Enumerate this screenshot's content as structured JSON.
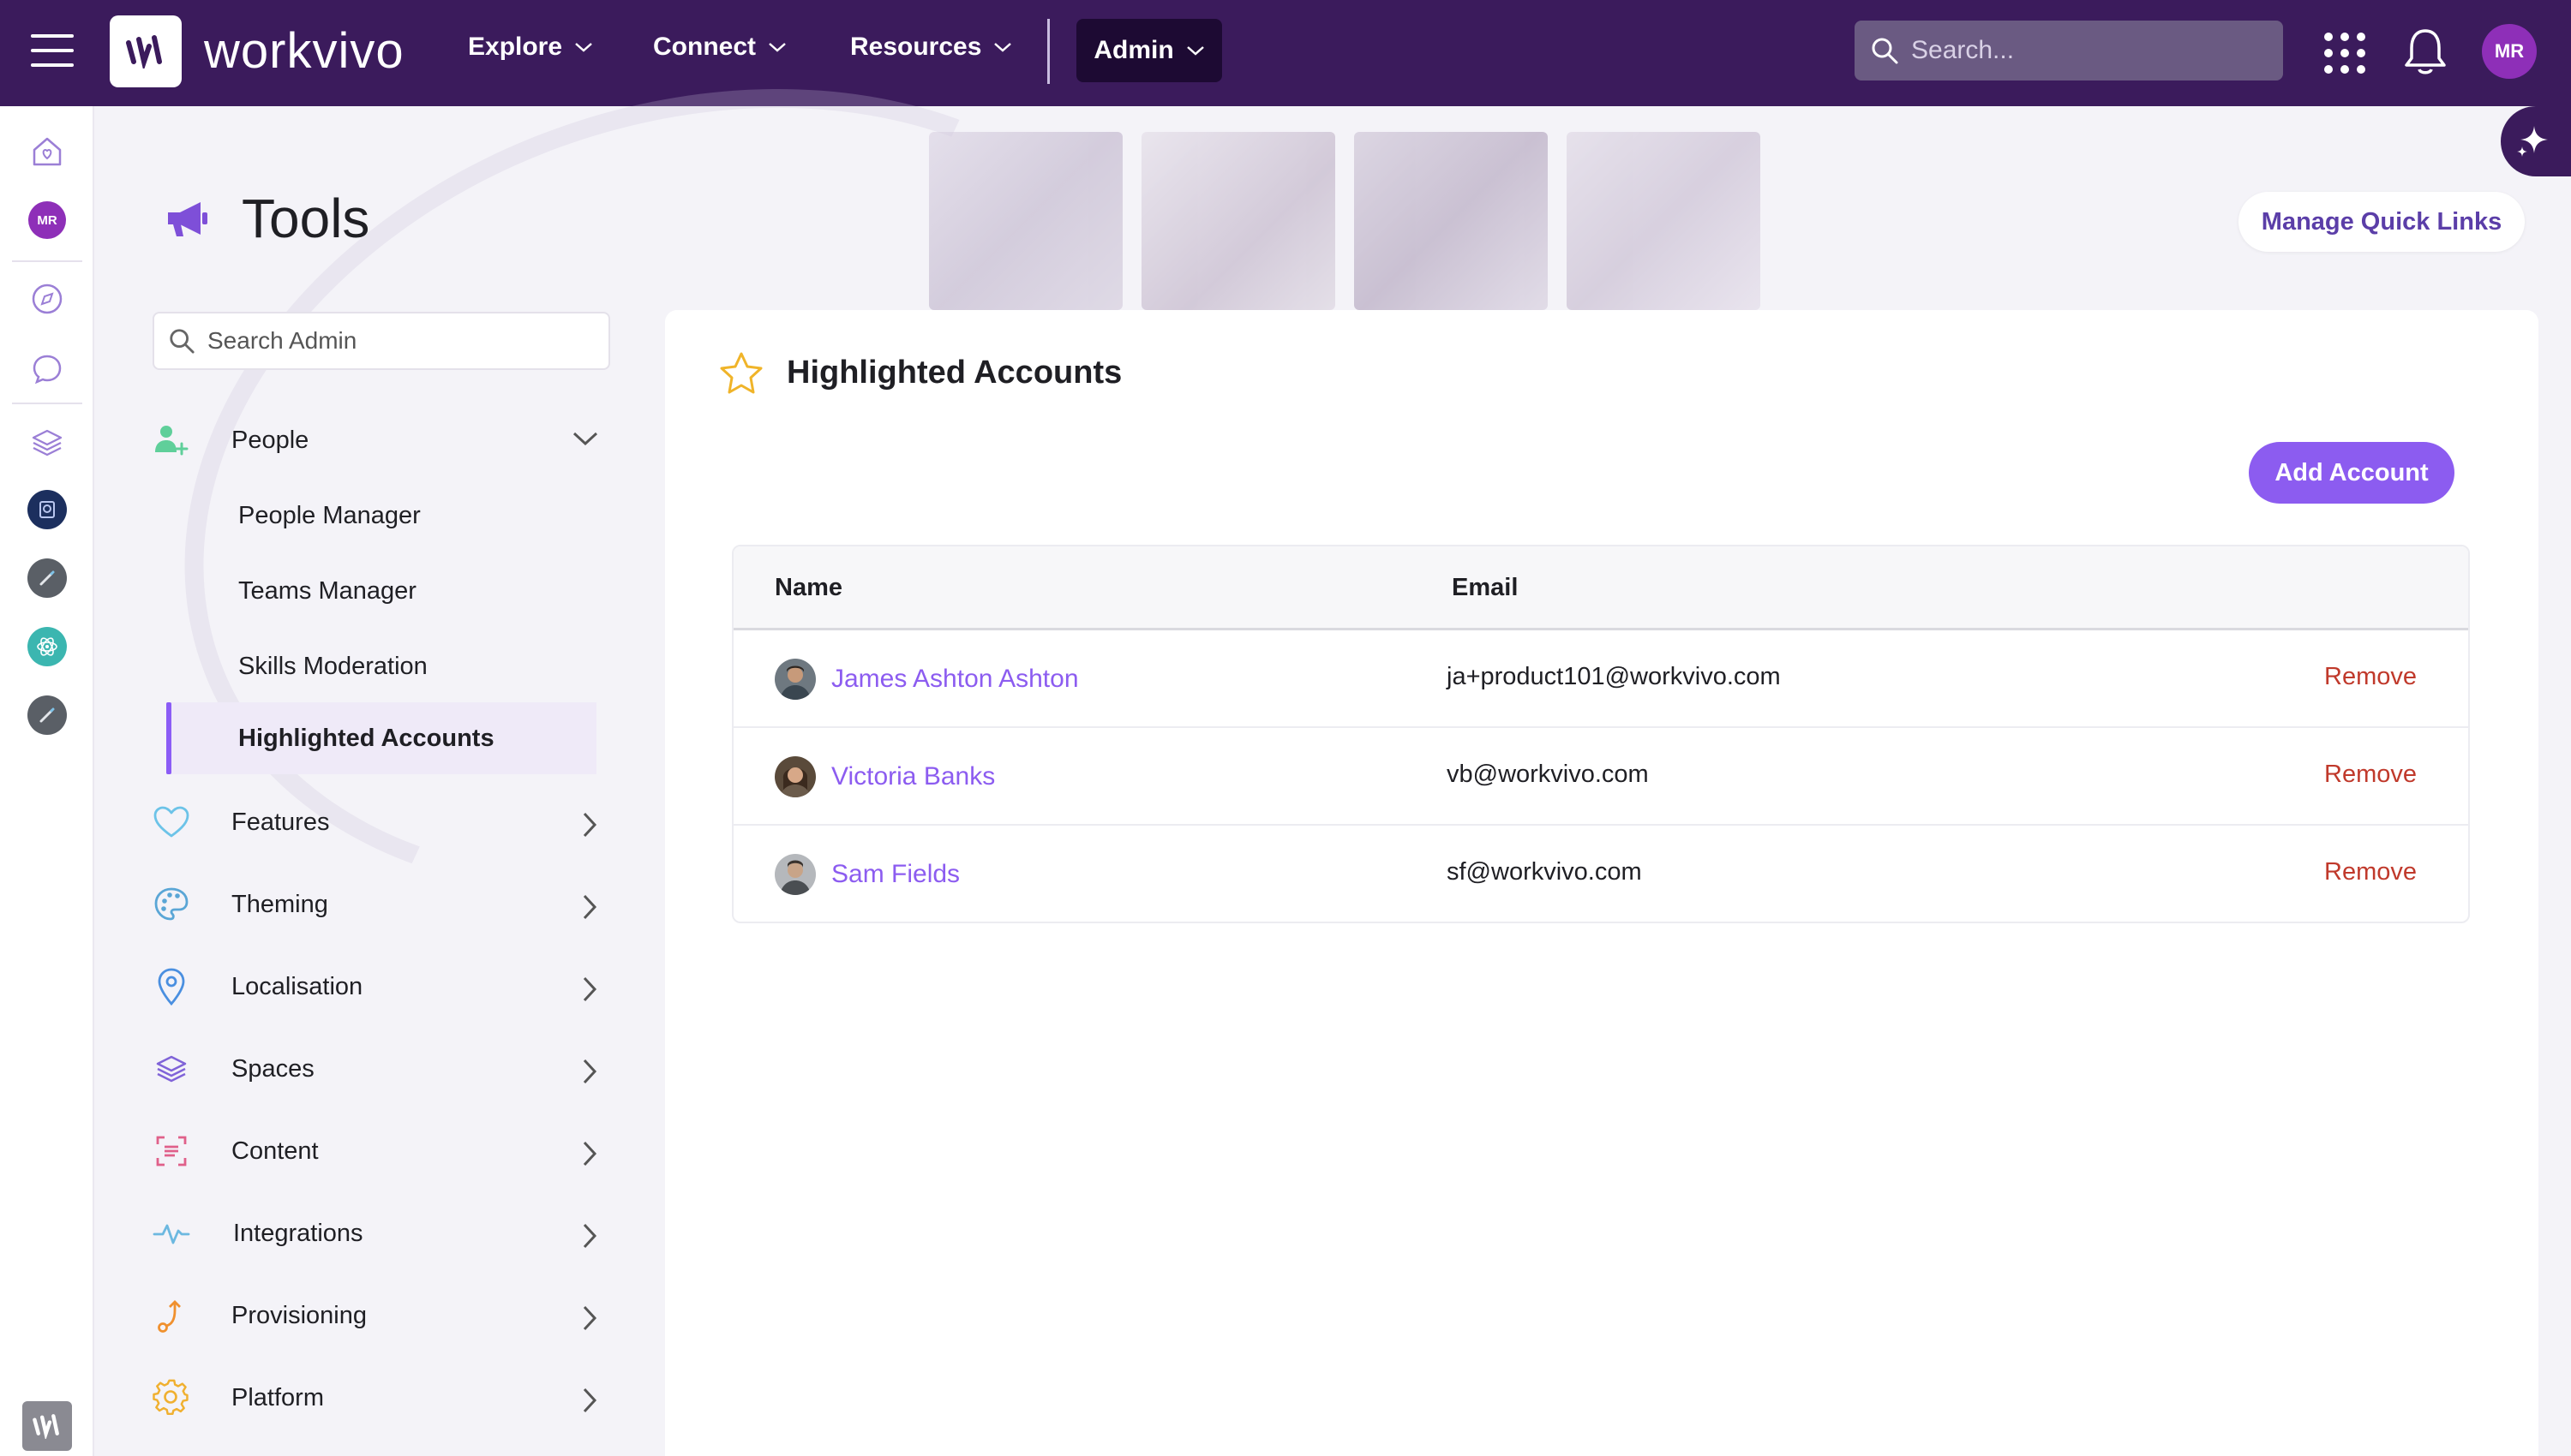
{
  "topbar": {
    "logo_text": "workvivo",
    "nav": [
      {
        "label": "Explore"
      },
      {
        "label": "Connect"
      },
      {
        "label": "Resources"
      }
    ],
    "admin_label": "Admin",
    "search_placeholder": "Search...",
    "avatar_initials": "MR"
  },
  "rail": {
    "avatar_initials": "MR"
  },
  "page": {
    "title": "Tools",
    "quick_links_label": "Manage Quick Links"
  },
  "sidebar": {
    "search_placeholder": "Search Admin",
    "people": {
      "label": "People",
      "sub_items": [
        {
          "label": "People Manager"
        },
        {
          "label": "Teams Manager"
        },
        {
          "label": "Skills Moderation"
        },
        {
          "label": "Highlighted Accounts"
        }
      ]
    },
    "items": [
      {
        "label": "Features"
      },
      {
        "label": "Theming"
      },
      {
        "label": "Localisation"
      },
      {
        "label": "Spaces"
      },
      {
        "label": "Content"
      },
      {
        "label": "Integrations"
      },
      {
        "label": "Provisioning"
      },
      {
        "label": "Platform"
      }
    ]
  },
  "main": {
    "title": "Highlighted Accounts",
    "add_button": "Add Account",
    "table": {
      "headers": {
        "name": "Name",
        "email": "Email"
      },
      "rows": [
        {
          "name": "James Ashton Ashton",
          "email": "ja+product101@workvivo.com",
          "action": "Remove"
        },
        {
          "name": "Victoria Banks",
          "email": "vb@workvivo.com",
          "action": "Remove"
        },
        {
          "name": "Sam Fields",
          "email": "sf@workvivo.com",
          "action": "Remove"
        }
      ]
    }
  },
  "colors": {
    "topbar": "#3b1b5c",
    "accent": "#8c5cf0",
    "remove": "#c0392b",
    "avatar": "#8e2fb8"
  }
}
